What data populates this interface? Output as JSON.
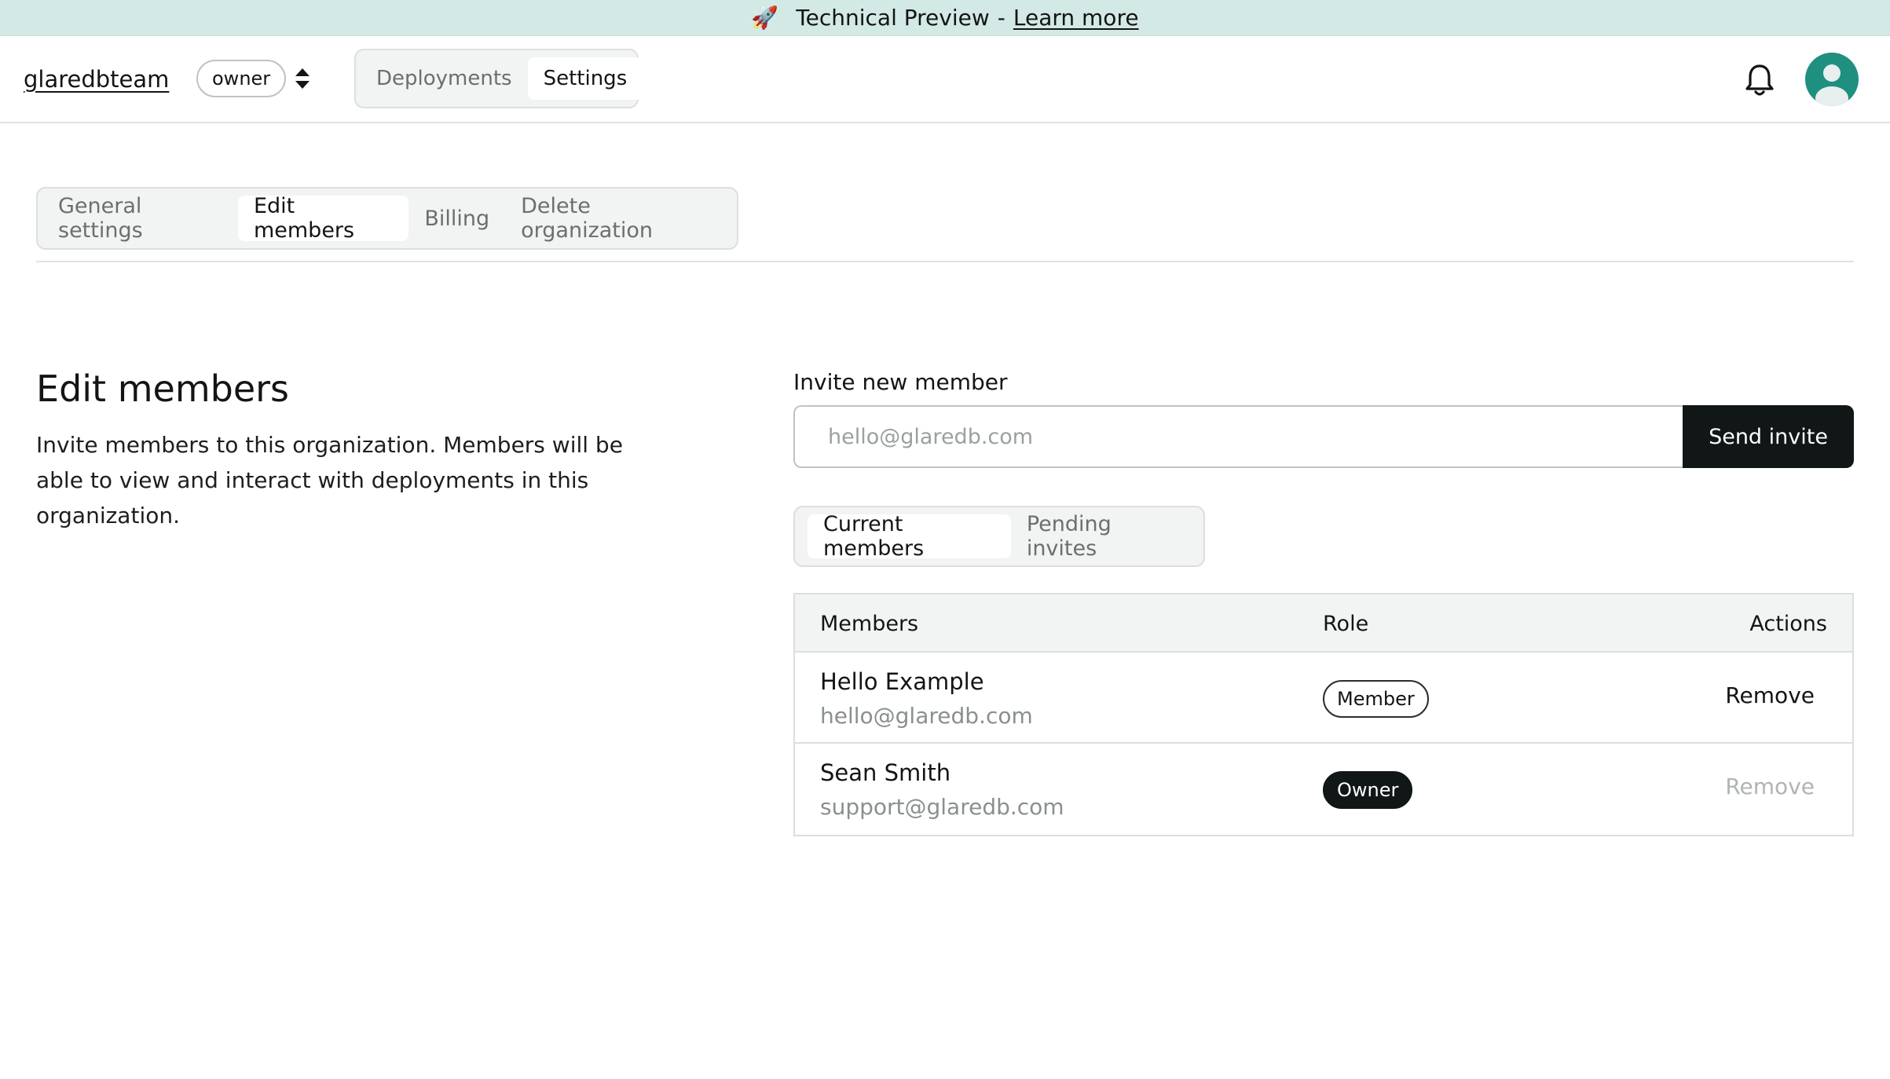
{
  "banner": {
    "icon": "rocket-icon",
    "text": "Technical Preview",
    "separator": "-",
    "link": "Learn more"
  },
  "header": {
    "org_name": "glaredbteam",
    "role": "owner",
    "nav": [
      {
        "label": "Deployments",
        "active": false
      },
      {
        "label": "Settings",
        "active": true
      }
    ],
    "icons": [
      "sort-icon",
      "bell-icon",
      "user-avatar-icon"
    ]
  },
  "settings_tabs": [
    {
      "label": "General settings",
      "active": false
    },
    {
      "label": "Edit members",
      "active": true
    },
    {
      "label": "Billing",
      "active": false
    },
    {
      "label": "Delete organization",
      "active": false
    }
  ],
  "section": {
    "title": "Edit members",
    "description": "Invite members to this organization. Members will be able to view and interact with deployments in this organization."
  },
  "invite": {
    "label": "Invite new member",
    "placeholder": "hello@glaredb.com",
    "value": "",
    "button": "Send invite"
  },
  "member_tabs": [
    {
      "label": "Current members",
      "active": true
    },
    {
      "label": "Pending invites",
      "active": false
    }
  ],
  "table": {
    "headers": {
      "members": "Members",
      "role": "Role",
      "actions": "Actions"
    },
    "rows": [
      {
        "name": "Hello Example",
        "email": "hello@glaredb.com",
        "role": "Member",
        "action": "Remove",
        "action_enabled": true
      },
      {
        "name": "Sean Smith",
        "email": "support@glaredb.com",
        "role": "Owner",
        "action": "Remove",
        "action_enabled": false
      }
    ]
  },
  "colors": {
    "banner_bg": "#d3e9e6",
    "primary_button": "#111616",
    "avatar": "#1f8f80",
    "muted_text": "#8a8f8f"
  }
}
